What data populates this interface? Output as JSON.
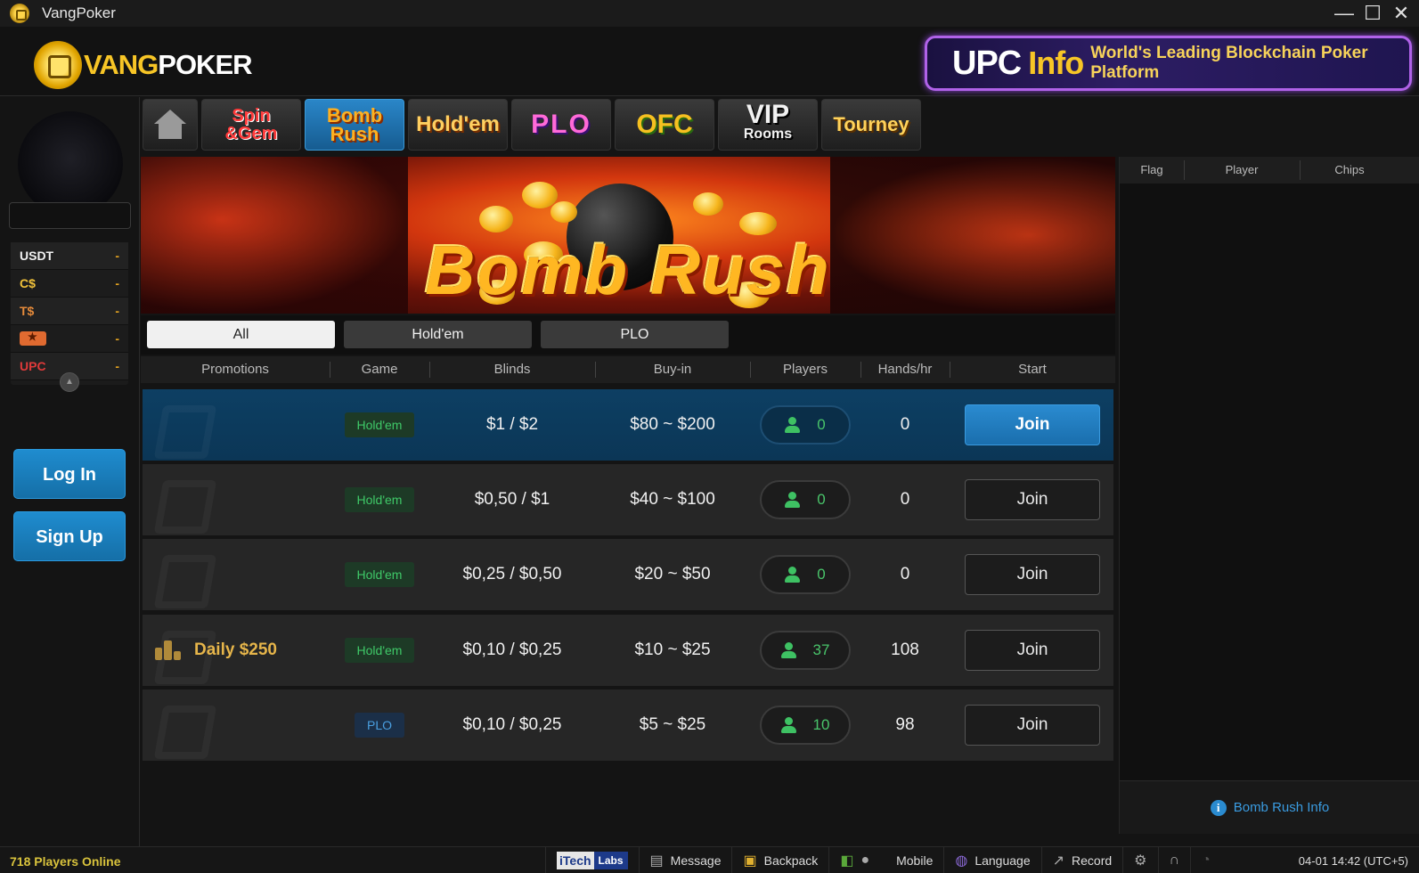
{
  "window": {
    "title": "VangPoker",
    "minimize": "—",
    "maximize": "☐",
    "close": "✕"
  },
  "brand": {
    "part1": "VANG",
    "part2": "POKER"
  },
  "upc_banner": {
    "big": "UPC",
    "info": "Info",
    "sub": "World's Leading Blockchain Poker Platform"
  },
  "sidebar": {
    "balances": [
      {
        "label": "USDT",
        "value": "-",
        "color": "#f2f2f2"
      },
      {
        "label": "C$",
        "value": "-",
        "color": "#f2c23a"
      },
      {
        "label": "T$",
        "value": "-",
        "color": "#e58a3a"
      },
      {
        "label": "",
        "value": "-",
        "color": "#e06a30",
        "icon": "ticket-icon"
      },
      {
        "label": "UPC",
        "value": "-",
        "color": "#e03a3a"
      }
    ],
    "login": "Log In",
    "signup": "Sign Up"
  },
  "game_nav": {
    "spin_line1": "Spin",
    "spin_line2": "&Gem",
    "bomb_line1": "Bomb",
    "bomb_line2": "Rush",
    "holdem": "Hold'em",
    "plo": "PLO",
    "ofc": "OFC",
    "vip_line1": "VIP",
    "vip_line2": "Rooms",
    "tourney": "Tourney",
    "active": "bomb-rush"
  },
  "hero": {
    "title": "Bomb Rush"
  },
  "filters": {
    "all": "All",
    "holdem": "Hold'em",
    "plo": "PLO",
    "active": "all"
  },
  "table": {
    "headers": {
      "promotions": "Promotions",
      "game": "Game",
      "blinds": "Blinds",
      "buyin": "Buy-in",
      "players": "Players",
      "hands": "Hands/hr",
      "start": "Start"
    },
    "rows": [
      {
        "promotion": "",
        "game": "Hold'em",
        "blinds": "$1 / $2",
        "buyin": "$80 ~ $200",
        "players": "0",
        "hands": "0",
        "action": "Join"
      },
      {
        "promotion": "",
        "game": "Hold'em",
        "blinds": "$0,50 / $1",
        "buyin": "$40 ~ $100",
        "players": "0",
        "hands": "0",
        "action": "Join"
      },
      {
        "promotion": "",
        "game": "Hold'em",
        "blinds": "$0,25 / $0,50",
        "buyin": "$20 ~ $50",
        "players": "0",
        "hands": "0",
        "action": "Join"
      },
      {
        "promotion": "Daily $250",
        "game": "Hold'em",
        "blinds": "$0,10 / $0,25",
        "buyin": "$10 ~ $25",
        "players": "37",
        "hands": "108",
        "action": "Join"
      },
      {
        "promotion": "",
        "game": "PLO",
        "blinds": "$0,10 / $0,25",
        "buyin": "$5 ~ $25",
        "players": "10",
        "hands": "98",
        "action": "Join"
      }
    ]
  },
  "right_panel": {
    "headers": {
      "flag": "Flag",
      "player": "Player",
      "chips": "Chips"
    },
    "info_link": "Bomb Rush Info"
  },
  "statusbar": {
    "online": "718 Players Online",
    "itech_a": "iTech",
    "itech_b": "Labs",
    "message": "Message",
    "backpack": "Backpack",
    "mobile": "Mobile",
    "language": "Language",
    "record": "Record",
    "time": "04-01 14:42 (UTC+5)"
  }
}
